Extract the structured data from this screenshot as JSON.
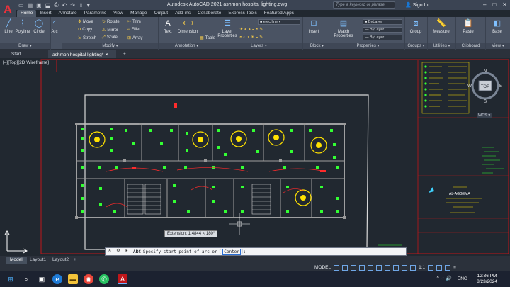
{
  "app": {
    "logo_letter": "A",
    "title": "Autodesk AutoCAD 2021    ashmon hospital lighting.dwg",
    "search_placeholder": "Type a keyword or phrase",
    "sign_in": "Sign In",
    "window_buttons": [
      "–",
      "□",
      "✕"
    ]
  },
  "ribbon_tabs": [
    "Home",
    "Insert",
    "Annotate",
    "Parametric",
    "View",
    "Manage",
    "Output",
    "Add-ins",
    "Collaborate",
    "Express Tools",
    "Featured Apps"
  ],
  "ribbon": {
    "draw": {
      "label": "Draw ▾",
      "tools": [
        "Line",
        "Polyline",
        "Circle",
        "Arc"
      ]
    },
    "modify": {
      "label": "Modify ▾",
      "tools": [
        "Move",
        "Rotate",
        "Trim",
        "Copy",
        "Mirror",
        "Fillet",
        "Stretch",
        "Scale",
        "Array"
      ]
    },
    "annotation": {
      "label": "Annotation ▾",
      "tools": [
        "Text",
        "Dimension",
        "Table"
      ]
    },
    "layers": {
      "label": "Layers ▾",
      "properties": "Layer Properties",
      "current_layer": "elec line"
    },
    "block": {
      "label": "Block ▾",
      "insert": "Insert"
    },
    "properties": {
      "label": "Properties ▾",
      "match": "Match Properties",
      "bylayer": [
        "ByLayer",
        "ByLayer",
        "ByLayer"
      ]
    },
    "groups": {
      "label": "Groups ▾",
      "group": "Group"
    },
    "utilities": {
      "label": "Utilities ▾",
      "measure": "Measure"
    },
    "clipboard": {
      "label": "Clipboard",
      "paste": "Paste"
    },
    "view": {
      "label": "View ▾",
      "base": "Base"
    }
  },
  "file_tabs": [
    "Start",
    "ashmon hospital lighting*",
    "+"
  ],
  "viewport": {
    "label": "[–][Top][2D Wireframe]",
    "viewcube": {
      "top": "TOP",
      "north": "N",
      "south": "S",
      "east": "E",
      "west": "W",
      "wcs": "WCS ▾"
    },
    "dynamic_tip": "Extension: 1.4844 < 180°",
    "title_block_name": "AL-AGGEMA"
  },
  "command": {
    "name": "ARC",
    "prompt": "Specify start point of arc or",
    "option": "Center",
    "suffix": "]:"
  },
  "layout_tabs": [
    "Model",
    "Layout1",
    "Layout2",
    "+"
  ],
  "status": {
    "model": "MODEL",
    "scale": "1:1"
  },
  "taskbar": {
    "time": "12:36 PM",
    "date": "8/23/2024",
    "lang": "ENG",
    "apps": [
      "windows-icon",
      "search-icon",
      "taskview-icon",
      "edge-icon",
      "explorer-icon",
      "chrome-icon",
      "whatsapp-icon",
      "autocad-icon"
    ]
  },
  "colors": {
    "accent": "#2a6fd6",
    "fixture": "#33ff33",
    "wall": "#cfcfcf",
    "red": "#ff2b2b",
    "yellow": "#ffe100",
    "frame": "#c0161a"
  }
}
